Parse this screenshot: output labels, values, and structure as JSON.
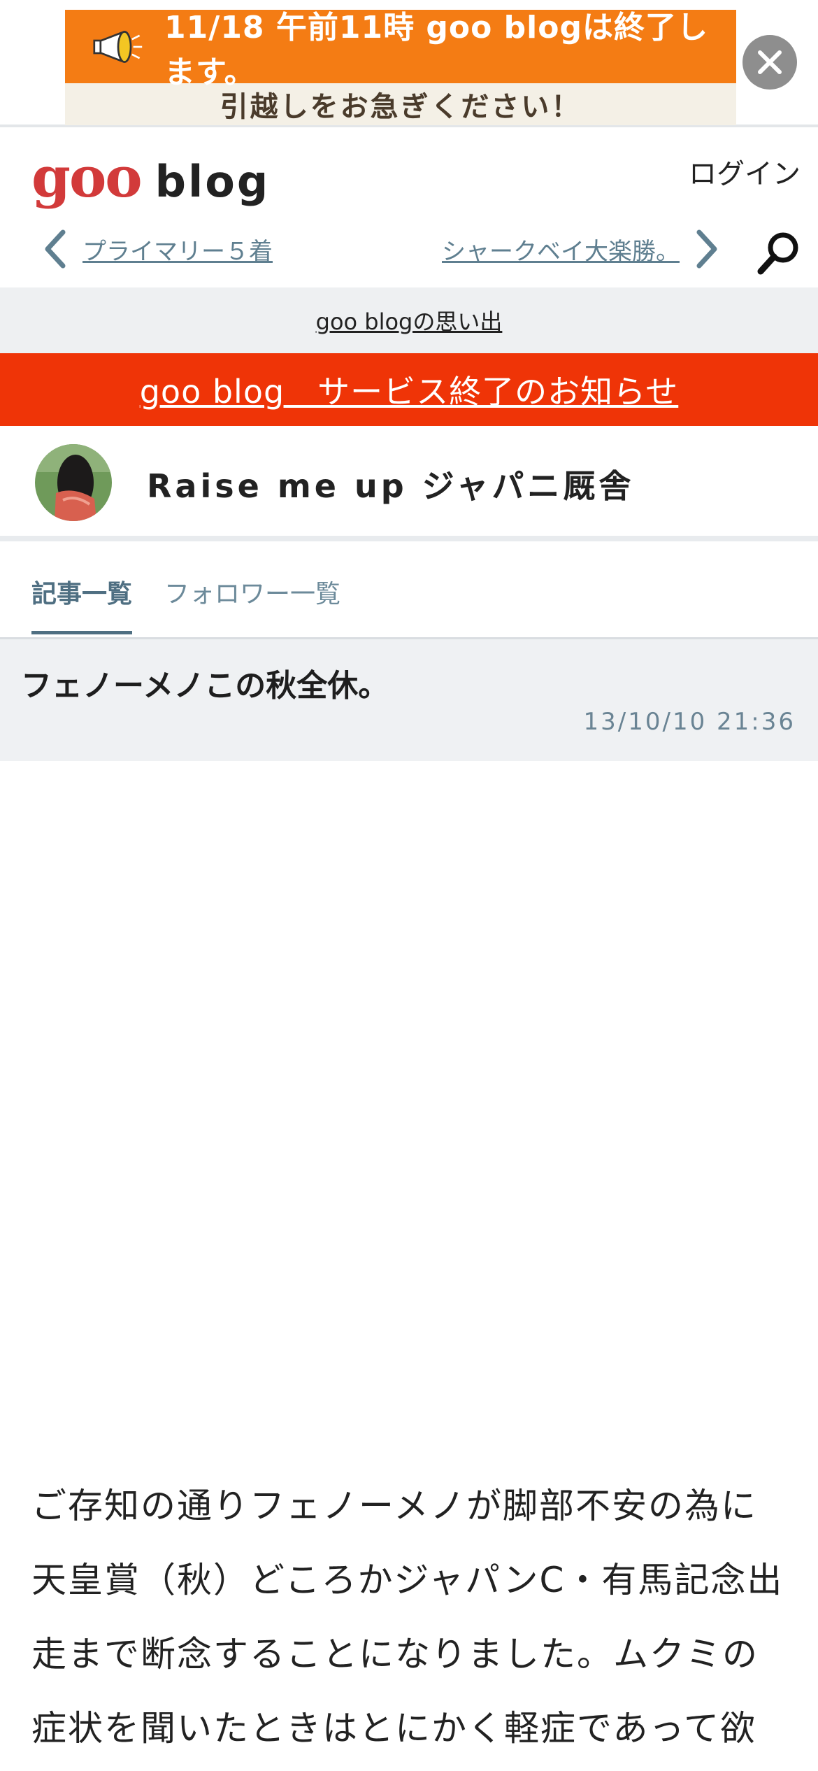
{
  "banner": {
    "line1": "11/18 午前11時 goo blogは終了します。",
    "line2": "引越しをお急ぎください！",
    "megaphone_icon": "megaphone-icon",
    "close_icon": "close-icon",
    "colors": {
      "top": "#f47c14",
      "bottom": "#f4f0e6",
      "close": "#8e8e8e"
    }
  },
  "header": {
    "logo_goo": "goo",
    "logo_blog": "blog",
    "login": "ログイン",
    "prev_article": "プライマリー５着",
    "next_article": "シャークベイ大楽勝。",
    "search_icon": "search-icon"
  },
  "memories_link": "goo blogの思い出",
  "notice_link": "goo blog　サービス終了のお知らせ",
  "blog": {
    "title": "Raise me up ジャパニ厩舎"
  },
  "tabs": [
    {
      "label": "記事一覧",
      "active": true
    },
    {
      "label": "フォロワー一覧",
      "active": false
    }
  ],
  "article": {
    "title": "フェノーメノこの秋全休。",
    "date": "13/10/10 21:36",
    "body_lines": [
      "ご存知の通りフェノーメノが脚部不安の為に",
      "天皇賞（秋）どころかジャパンC・有馬記念出",
      "走まで断念することになりました。ムクミの",
      "症状を聞いたときはとにかく軽症であって欲"
    ]
  },
  "colors": {
    "notice_red": "#ef3407",
    "accent": "#4f6f82",
    "logo_red": "#d23a3a"
  }
}
